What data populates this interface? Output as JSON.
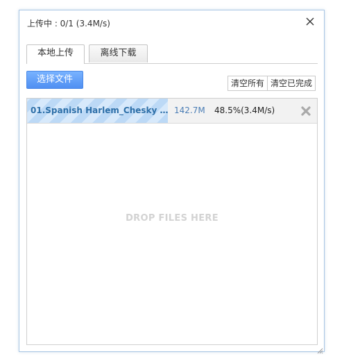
{
  "dialog": {
    "title": "上传中 : 0/1 (3.4M/s)"
  },
  "tabs": [
    {
      "label": "本地上传",
      "active": true
    },
    {
      "label": "离线下载",
      "active": false
    }
  ],
  "toolbar": {
    "select_label": "选择文件",
    "clear_all_label": "清空所有",
    "clear_done_label": "清空已完成"
  },
  "files": [
    {
      "name": "01.Spanish Harlem_Chesky R...",
      "size": "142.7M",
      "progress": "48.5%(3.4M/s)",
      "progress_fraction": 0.485
    }
  ],
  "dropzone": {
    "text": "DROP FILES HERE"
  },
  "colors": {
    "accent": "#4f8ff2",
    "file_name": "#2d6fa8",
    "progress_stripe": "#bcd9f6"
  }
}
